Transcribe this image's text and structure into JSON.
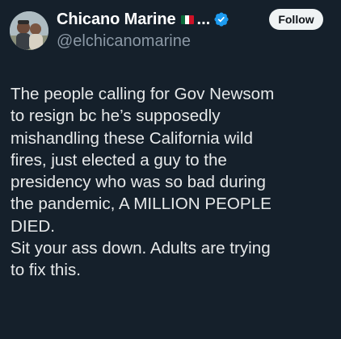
{
  "author": {
    "display_name": "Chicano Marine",
    "flag": "mexico-flag",
    "ellipsis": "...",
    "verified_icon": "verified-badge-icon",
    "handle": "@elchicanomarine"
  },
  "follow_button": {
    "label": "Follow"
  },
  "tweet": {
    "lines": [
      "The people calling for Gov Newsom",
      "to resign bc he’s supposedly",
      "mishandling these California wild",
      "fires, just elected a guy to the",
      "presidency who was so bad during",
      "the pandemic, A MILLION PEOPLE",
      "DIED.",
      "Sit your ass down. Adults are trying",
      "to fix this."
    ]
  },
  "colors": {
    "background": "#15202b",
    "text": "#e7e9ea",
    "handle": "#8b98a5",
    "verified": "#1d9bf0",
    "follow_bg": "#eff3f4"
  }
}
